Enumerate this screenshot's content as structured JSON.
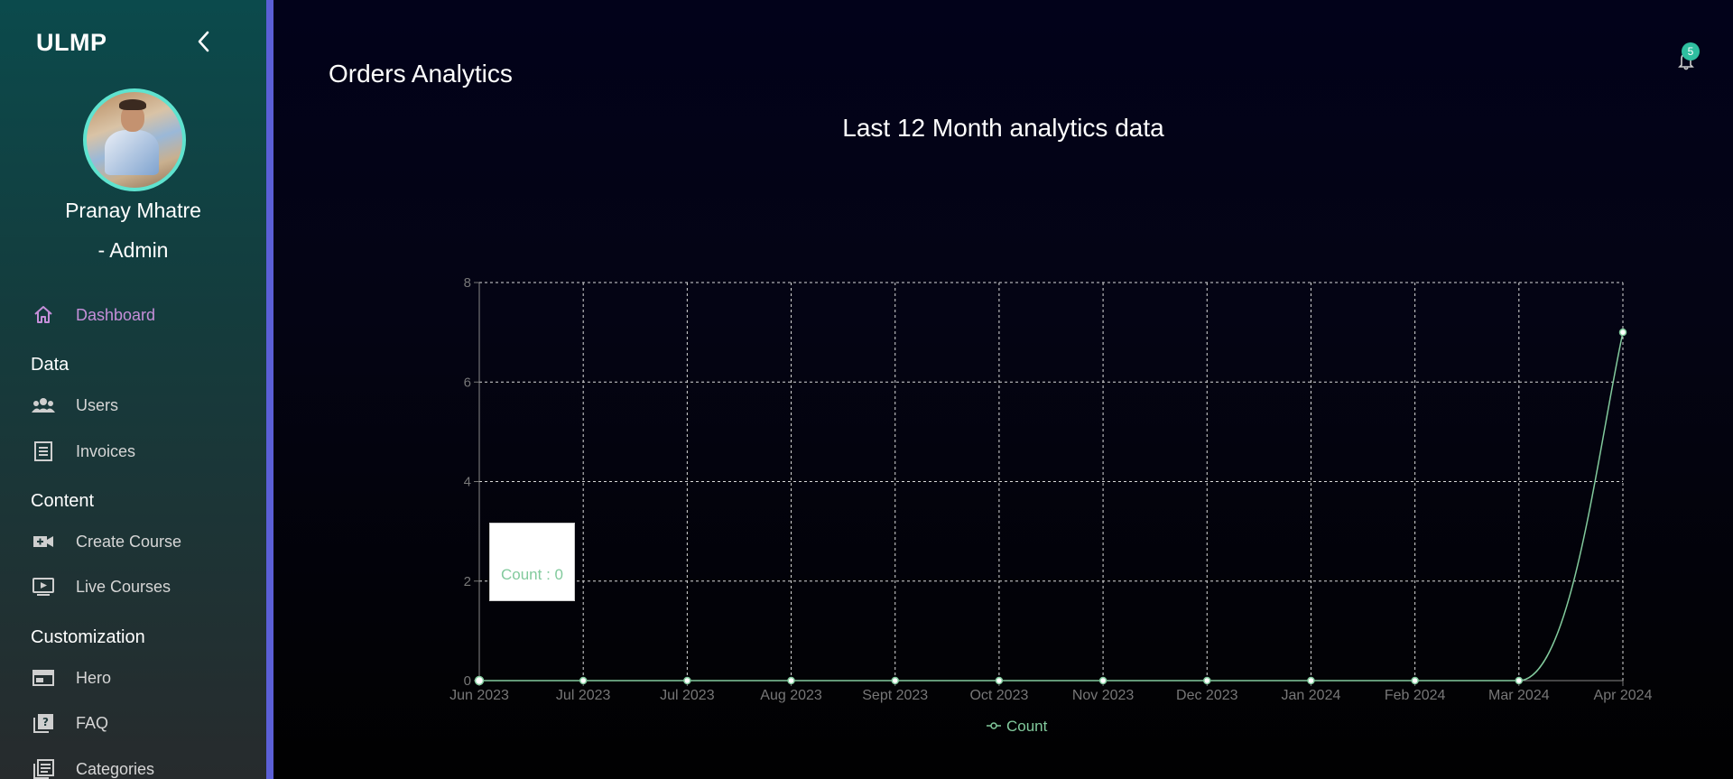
{
  "app": {
    "brand": "ULMP"
  },
  "user": {
    "name": "Pranay Mhatre",
    "role": "- Admin"
  },
  "sidebar": {
    "dashboard": {
      "label": "Dashboard",
      "icon": "home-icon"
    },
    "sections": [
      {
        "title": "Data",
        "items": [
          {
            "label": "Users",
            "icon": "users-icon"
          },
          {
            "label": "Invoices",
            "icon": "receipt-icon"
          }
        ]
      },
      {
        "title": "Content",
        "items": [
          {
            "label": "Create Course",
            "icon": "video-add-icon"
          },
          {
            "label": "Live Courses",
            "icon": "ondemand-video-icon"
          }
        ]
      },
      {
        "title": "Customization",
        "items": [
          {
            "label": "Hero",
            "icon": "web-icon"
          },
          {
            "label": "FAQ",
            "icon": "quiz-icon"
          },
          {
            "label": "Categories",
            "icon": "wysiwyg-icon"
          }
        ]
      }
    ]
  },
  "header": {
    "page_title": "Orders Analytics",
    "notification_count": "5"
  },
  "colors": {
    "accent_line": "#82ca9d",
    "active_nav": "#c58fd9",
    "sidebar_edge": "#5b5fd6",
    "badge": "#2fbfa0"
  },
  "tooltip": {
    "text": "Count : 0"
  },
  "chart_data": {
    "type": "line",
    "title": "Last 12 Month analytics data",
    "categories": [
      "Jun 2023",
      "Jul 2023",
      "Jul 2023",
      "Aug 2023",
      "Sept 2023",
      "Oct 2023",
      "Nov 2023",
      "Dec 2023",
      "Jan 2024",
      "Feb 2024",
      "Mar 2024",
      "Apr 2024"
    ],
    "series": [
      {
        "name": "Count",
        "values": [
          0,
          0,
          0,
          0,
          0,
          0,
          0,
          0,
          0,
          0,
          0,
          7
        ]
      }
    ],
    "ylim": [
      0,
      8
    ],
    "yticks": [
      0,
      2,
      4,
      6,
      8
    ],
    "grid": true,
    "legend": "bottom"
  }
}
